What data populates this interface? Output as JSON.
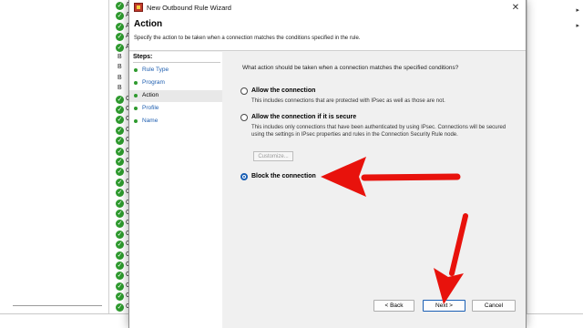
{
  "window": {
    "title": "New Outbound Rule Wizard",
    "close_glyph": "✕"
  },
  "header": {
    "title": "Action",
    "subtitle": "Specify the action to be taken when a connection matches the conditions specified in the rule."
  },
  "steps": {
    "label": "Steps:",
    "items": [
      {
        "label": "Rule Type"
      },
      {
        "label": "Program"
      },
      {
        "label": "Action",
        "current": true
      },
      {
        "label": "Profile"
      },
      {
        "label": "Name"
      }
    ]
  },
  "content": {
    "question": "What action should be taken when a connection matches the specified conditions?",
    "options": [
      {
        "label": "Allow the connection",
        "description": "This includes connections that are protected with IPsec as well as those are not.",
        "checked": false
      },
      {
        "label": "Allow the connection if it is secure",
        "description": "This includes only connections that have been authenticated by using IPsec.  Connections will be secured using the settings in IPsec properties and rules in the Connection Security Rule node.",
        "checked": false
      },
      {
        "label": "Block the connection",
        "description": "",
        "checked": true
      }
    ],
    "customize_label": "Customize..."
  },
  "buttons": {
    "back": "< Back",
    "next": "Next >",
    "cancel": "Cancel"
  },
  "background": {
    "list_letters": [
      "A",
      "A",
      "A",
      "A",
      "A",
      "B",
      "B",
      "B",
      "B",
      "C",
      "C",
      "C",
      "C",
      "C",
      "C",
      "C",
      "C",
      "C",
      "C",
      "C",
      "C",
      "C",
      "C",
      "C",
      "C",
      "C",
      "C",
      "C",
      "C",
      "C"
    ]
  },
  "colors": {
    "accent": "#1a5fb4",
    "step_link": "#1f5fb0",
    "annotation_arrow": "#e8120c",
    "check_green": "#2e9a2e"
  }
}
